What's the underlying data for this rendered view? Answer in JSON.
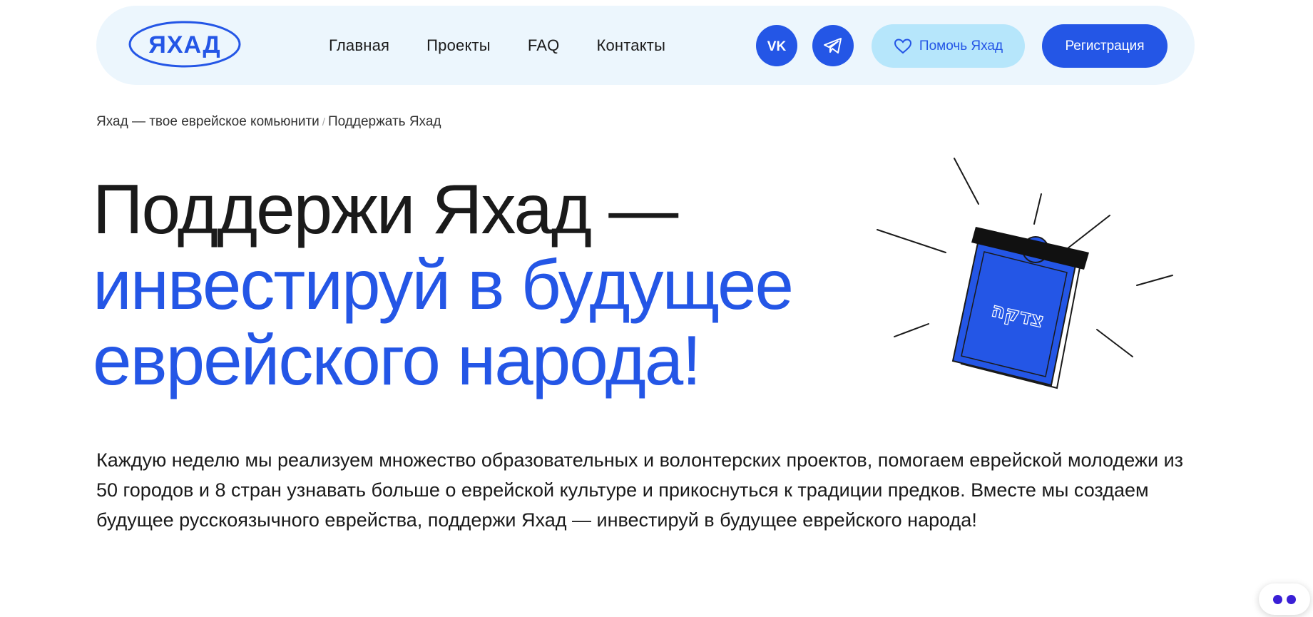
{
  "header": {
    "logo_text": "ЯХАД",
    "nav": [
      "Главная",
      "Проекты",
      "FAQ",
      "Контакты"
    ],
    "social_icons": [
      "vk-icon",
      "telegram-icon"
    ],
    "help_button": "Помочь Яхад",
    "register_button": "Регистрация"
  },
  "breadcrumb": {
    "home": "Яхад — твое еврейское комьюнити",
    "separator": "/",
    "current": "Поддержать Яхад"
  },
  "hero": {
    "title_line1": "Поддержи Яхад —",
    "title_line2": "инвестируй в будущее",
    "title_line3": "еврейского народа!",
    "text": "Каждую неделю мы реализуем множество образовательных и волонтерских проектов, помогаем еврейской молодежи из 50 городов и 8 стран узнавать больше о еврейской культуре и прикоснуться к традиции предков. Вместе мы создаем будущее русскоязычного еврейства, поддержи Яхад — инвестируй в будущее еврейского народа!",
    "box_label": "צדקה"
  },
  "colors": {
    "brand_blue": "#2456e6",
    "header_bg": "#ecf6fd",
    "help_bg": "#b6e6fb"
  }
}
